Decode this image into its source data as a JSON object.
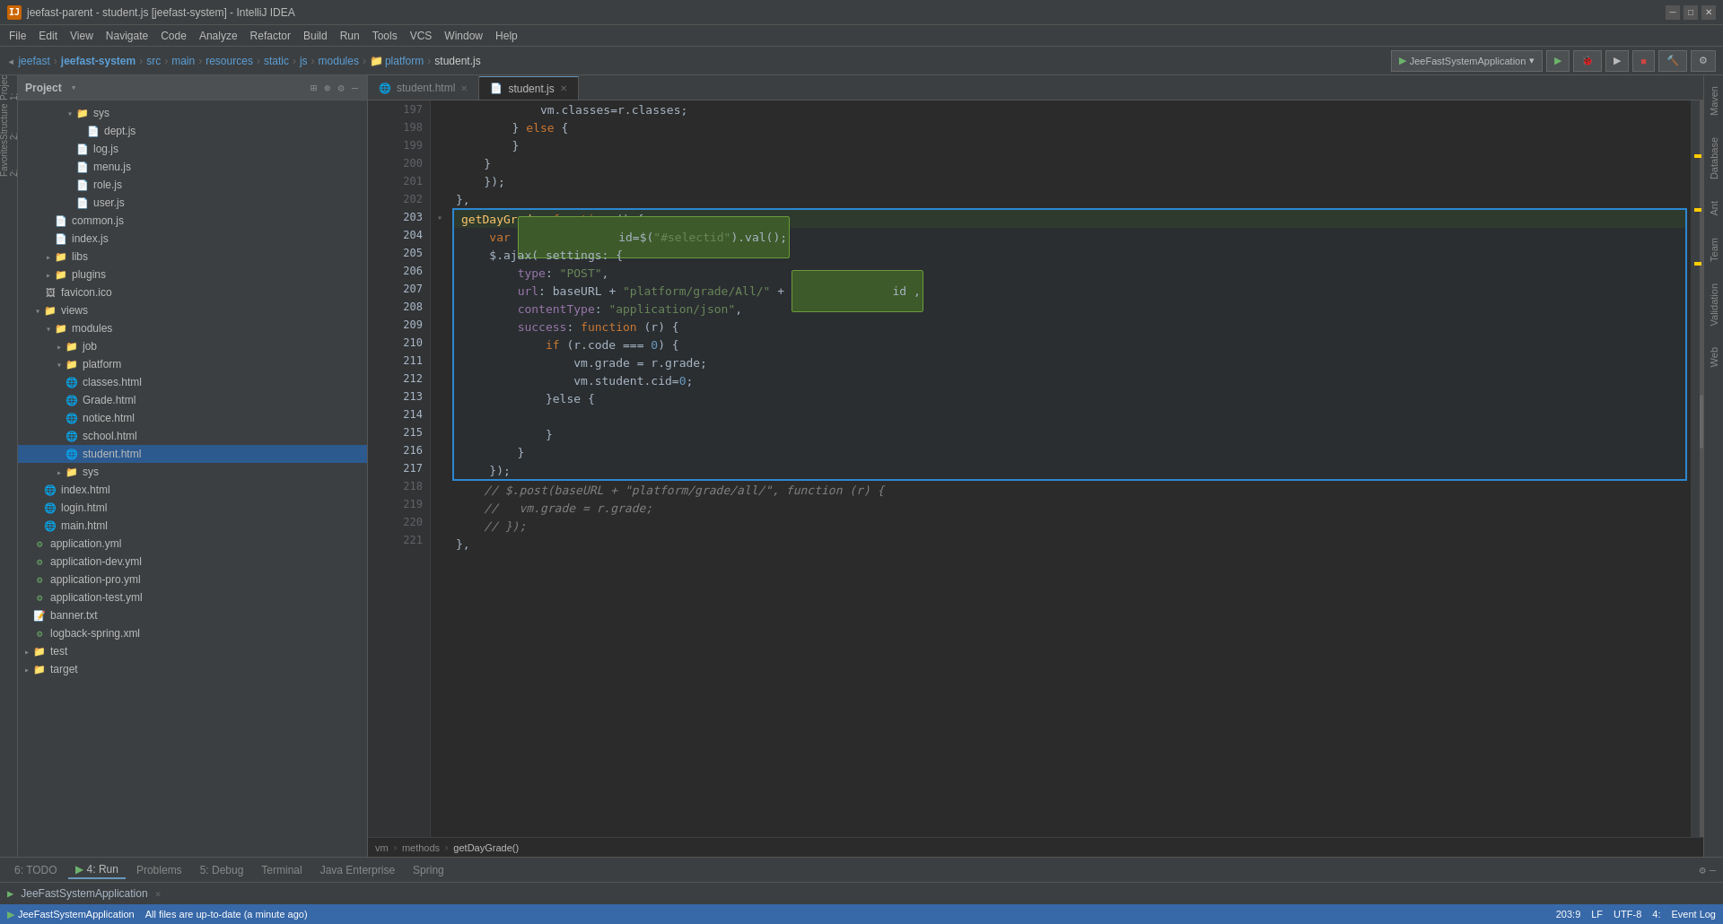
{
  "window": {
    "title": "jeefast-parent - student.js [jeefast-system] - IntelliJ IDEA",
    "icon": "IJ"
  },
  "menubar": {
    "items": [
      "File",
      "Edit",
      "View",
      "Navigate",
      "Code",
      "Analyze",
      "Refactor",
      "Build",
      "Run",
      "Tools",
      "VCS",
      "Window",
      "Help"
    ]
  },
  "toolbar": {
    "breadcrumb": [
      "jeefast",
      "jeefast-system",
      "src",
      "main",
      "resources",
      "static",
      "js",
      "modules",
      "platform",
      "student.js"
    ],
    "run_config": "JeeFastSystemApplication",
    "run_config_dropdown": "▾"
  },
  "project_panel": {
    "title": "Project",
    "tree": [
      {
        "id": "sys",
        "label": "sys",
        "type": "folder",
        "indent": 3,
        "expanded": true
      },
      {
        "id": "dept",
        "label": "dept.js",
        "type": "js",
        "indent": 4
      },
      {
        "id": "log",
        "label": "log.js",
        "type": "js",
        "indent": 4
      },
      {
        "id": "menu",
        "label": "menu.js",
        "type": "js",
        "indent": 4
      },
      {
        "id": "role",
        "label": "role.js",
        "type": "js",
        "indent": 4
      },
      {
        "id": "user",
        "label": "user.js",
        "type": "js",
        "indent": 4
      },
      {
        "id": "common",
        "label": "common.js",
        "type": "js",
        "indent": 3
      },
      {
        "id": "index_js",
        "label": "index.js",
        "type": "js",
        "indent": 3
      },
      {
        "id": "libs",
        "label": "libs",
        "type": "folder",
        "indent": 2,
        "expanded": false
      },
      {
        "id": "plugins",
        "label": "plugins",
        "type": "folder",
        "indent": 2,
        "expanded": false
      },
      {
        "id": "favicon",
        "label": "favicon.ico",
        "type": "ico",
        "indent": 2
      },
      {
        "id": "views",
        "label": "views",
        "type": "folder",
        "indent": 1,
        "expanded": true
      },
      {
        "id": "modules",
        "label": "modules",
        "type": "folder",
        "indent": 2,
        "expanded": true
      },
      {
        "id": "job",
        "label": "job",
        "type": "folder",
        "indent": 3,
        "expanded": false
      },
      {
        "id": "platform",
        "label": "platform",
        "type": "folder",
        "indent": 3,
        "expanded": true
      },
      {
        "id": "classes",
        "label": "classes.html",
        "type": "html",
        "indent": 4
      },
      {
        "id": "grade",
        "label": "Grade.html",
        "type": "html",
        "indent": 4
      },
      {
        "id": "notice",
        "label": "notice.html",
        "type": "html",
        "indent": 4
      },
      {
        "id": "school",
        "label": "school.html",
        "type": "html",
        "indent": 4
      },
      {
        "id": "student_html",
        "label": "student.html",
        "type": "html",
        "indent": 4,
        "selected": true
      },
      {
        "id": "sys2",
        "label": "sys",
        "type": "folder",
        "indent": 3,
        "expanded": false
      },
      {
        "id": "index_html",
        "label": "index.html",
        "type": "html",
        "indent": 2
      },
      {
        "id": "login",
        "label": "login.html",
        "type": "html",
        "indent": 2
      },
      {
        "id": "main",
        "label": "main.html",
        "type": "html",
        "indent": 2
      },
      {
        "id": "application",
        "label": "application.yml",
        "type": "yml",
        "indent": 1
      },
      {
        "id": "app_dev",
        "label": "application-dev.yml",
        "type": "yml",
        "indent": 1
      },
      {
        "id": "app_pro",
        "label": "application-pro.yml",
        "type": "yml",
        "indent": 1
      },
      {
        "id": "app_test",
        "label": "application-test.yml",
        "type": "yml",
        "indent": 1
      },
      {
        "id": "banner",
        "label": "banner.txt",
        "type": "txt",
        "indent": 1
      },
      {
        "id": "logback",
        "label": "logback-spring.xml",
        "type": "xml",
        "indent": 1
      },
      {
        "id": "test",
        "label": "test",
        "type": "folder",
        "indent": 0,
        "expanded": false
      },
      {
        "id": "target",
        "label": "target",
        "type": "folder",
        "indent": 0,
        "expanded": false
      }
    ]
  },
  "tabs": [
    {
      "id": "student_html_tab",
      "label": "student.html",
      "active": false,
      "icon": "html"
    },
    {
      "id": "student_js_tab",
      "label": "student.js",
      "active": true,
      "icon": "js"
    }
  ],
  "code_lines": [
    {
      "num": 197,
      "content": "            vm.classes=r.classes;",
      "selected": false
    },
    {
      "num": 198,
      "content": "        } else {",
      "selected": false
    },
    {
      "num": 199,
      "content": "        }",
      "selected": false
    },
    {
      "num": 200,
      "content": "    }",
      "selected": false
    },
    {
      "num": 201,
      "content": "    });",
      "selected": false
    },
    {
      "num": 202,
      "content": "},",
      "selected": false
    },
    {
      "num": 203,
      "content": "getDayGrade :function () {",
      "selected": true,
      "block_start": true
    },
    {
      "num": 204,
      "content": "    var id=$(\"#selectid\").val();",
      "selected": true,
      "highlight_var": true
    },
    {
      "num": 205,
      "content": "    $.ajax( settings: {",
      "selected": true
    },
    {
      "num": 206,
      "content": "        type: \"POST\",",
      "selected": true
    },
    {
      "num": 207,
      "content": "        url: baseURL + \"platform/grade/All/\" + id ,",
      "selected": true,
      "highlight_id": true
    },
    {
      "num": 208,
      "content": "        contentType: \"application/json\",",
      "selected": true
    },
    {
      "num": 209,
      "content": "        success: function (r) {",
      "selected": true
    },
    {
      "num": 210,
      "content": "            if (r.code === 0) {",
      "selected": true
    },
    {
      "num": 211,
      "content": "                vm.grade = r.grade;",
      "selected": true
    },
    {
      "num": 212,
      "content": "                vm.student.cid=0;",
      "selected": true
    },
    {
      "num": 213,
      "content": "            }else {",
      "selected": true
    },
    {
      "num": 214,
      "content": "",
      "selected": true
    },
    {
      "num": 215,
      "content": "            }",
      "selected": true
    },
    {
      "num": 216,
      "content": "        }",
      "selected": true
    },
    {
      "num": 217,
      "content": "    });",
      "selected": true,
      "block_end": true
    },
    {
      "num": 218,
      "content": "    // $.post(baseURL + \"platform/grade/all/\", function (r) {",
      "selected": false,
      "comment": true
    },
    {
      "num": 219,
      "content": "    //   vm.grade = r.grade;",
      "selected": false,
      "comment": true
    },
    {
      "num": 220,
      "content": "    // });",
      "selected": false,
      "comment": true
    },
    {
      "num": 221,
      "content": "},",
      "selected": false
    }
  ],
  "editor_breadcrumb": {
    "items": [
      "vm",
      "methods",
      "getDayGrade()"
    ]
  },
  "run_panel": {
    "tabs": [
      "6: TODO",
      "4: Run",
      "Problems",
      "5: Debug",
      "Terminal",
      "Java Enterprise",
      "Spring"
    ],
    "active_tab": "4: Run",
    "run_app": "JeeFastSystemApplication",
    "status_text": "All files are up-to-date (a minute ago)"
  },
  "status_bar": {
    "left": [
      "6: TODO",
      "4: Run",
      "Problems",
      "5: Debug",
      "Terminal",
      "Java Enterprise",
      "Spring"
    ],
    "right_items": [
      "203:9",
      "LF",
      "UTF-8",
      "4:",
      "Event Log"
    ],
    "message": "All files are up-to-date (a minute ago)",
    "position": "203:9",
    "encoding": "UTF-8",
    "line_sep": "LF"
  },
  "right_panel_tabs": [
    "Maven",
    "Database",
    "Ant",
    "Team",
    "Validation",
    "Web"
  ],
  "colors": {
    "accent_blue": "#2d87d0",
    "selected_bg": "#2d5a8e",
    "active_tab_border": "#6897bb",
    "keyword": "#cc7832",
    "string": "#6a8759",
    "function_color": "#ffc66d",
    "number": "#6897bb",
    "comment": "#808080",
    "property": "#9876aa",
    "highlight_green_bg": "#3d5a2a",
    "highlight_green_border": "#6a9b3a"
  }
}
